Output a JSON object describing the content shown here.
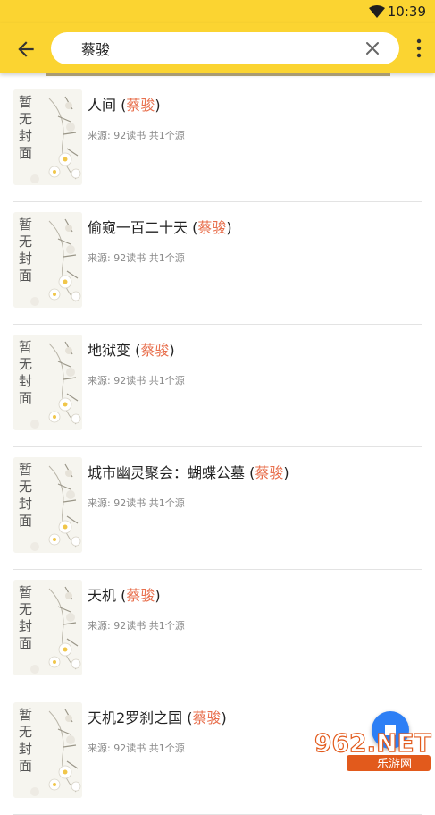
{
  "status_bar": {
    "time": "10:39"
  },
  "search": {
    "query": "蔡骏"
  },
  "colors": {
    "accent": "#fbd431",
    "author": "#e8704e",
    "fab": "#2d7ff5"
  },
  "cover_placeholder": "暂无封面",
  "results": [
    {
      "title": "人间",
      "author": "蔡骏",
      "source": "来源: 92读书",
      "count": "共1个源"
    },
    {
      "title": "偷窥一百二十天",
      "author": "蔡骏",
      "source": "来源: 92读书",
      "count": "共1个源"
    },
    {
      "title": "地狱变",
      "author": "蔡骏",
      "source": "来源: 92读书",
      "count": "共1个源"
    },
    {
      "title": "城市幽灵聚会：蝴蝶公墓",
      "author": "蔡骏",
      "source": "来源: 92读书",
      "count": "共1个源"
    },
    {
      "title": "天机",
      "author": "蔡骏",
      "source": "来源: 92读书",
      "count": "共1个源"
    },
    {
      "title": "天机2罗刹之国",
      "author": "蔡骏",
      "source": "来源: 92读书",
      "count": "共1个源"
    }
  ],
  "watermark": {
    "main": "962.NET",
    "sub": "乐游网"
  }
}
